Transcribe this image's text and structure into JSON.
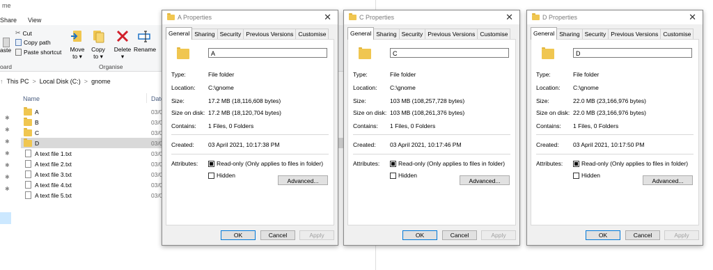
{
  "explorer": {
    "title_fragment": "me",
    "menu_tabs": [
      "Share",
      "View"
    ],
    "ribbon": {
      "cut": "Cut",
      "copy_path": "Copy path",
      "paste_shortcut": "Paste shortcut",
      "paste_fragment": "aste",
      "move_to_line1": "Move",
      "move_to_line2": "to ▾",
      "copy_to_line1": "Copy",
      "copy_to_line2": "to ▾",
      "delete_line1": "Delete",
      "delete_line2": "▾",
      "rename": "Rename",
      "clipboard_fragment": "oard",
      "organise": "Organise"
    },
    "address": {
      "nav_arrow": "↑",
      "crumbs": [
        "This PC",
        "Local Disk (C:)",
        "gnome"
      ],
      "separator": ">"
    },
    "columns": {
      "name": "Name",
      "date": "Date"
    },
    "files": [
      {
        "name": "A",
        "date": "03/0",
        "type": "folder"
      },
      {
        "name": "B",
        "date": "03/0",
        "type": "folder"
      },
      {
        "name": "C",
        "date": "03/0",
        "type": "folder"
      },
      {
        "name": "D",
        "date": "03/0",
        "type": "folder"
      },
      {
        "name": "A text file 1.txt",
        "date": "03/0",
        "type": "text"
      },
      {
        "name": "A text file 2.txt",
        "date": "03/0",
        "type": "text"
      },
      {
        "name": "A text file 3.txt",
        "date": "03/0",
        "type": "text"
      },
      {
        "name": "A text file 4.txt",
        "date": "03/0",
        "type": "text"
      },
      {
        "name": "A text file 5.txt",
        "date": "03/0",
        "type": "text"
      }
    ]
  },
  "labels": {
    "tabs": [
      "General",
      "Sharing",
      "Security",
      "Previous Versions",
      "Customise"
    ],
    "type": "Type:",
    "location": "Location:",
    "size": "Size:",
    "size_on_disk": "Size on disk:",
    "contains": "Contains:",
    "created": "Created:",
    "attributes": "Attributes:",
    "readonly": "Read-only (Only applies to files in folder)",
    "hidden": "Hidden",
    "advanced": "Advanced...",
    "ok": "OK",
    "cancel": "Cancel",
    "apply": "Apply",
    "close_glyph": "✕"
  },
  "dialogs": [
    {
      "title": "A Properties",
      "name": "A",
      "type": "File folder",
      "location": "C:\\gnome",
      "size": "17.2 MB (18,116,608 bytes)",
      "size_on_disk": "17.2 MB (18,120,704 bytes)",
      "contains": "1 Files, 0 Folders",
      "created": "03 April 2021, 10:17:38 PM"
    },
    {
      "title": "C Properties",
      "name": "C",
      "type": "File folder",
      "location": "C:\\gnome",
      "size": "103 MB (108,257,728 bytes)",
      "size_on_disk": "103 MB (108,261,376 bytes)",
      "contains": "1 Files, 0 Folders",
      "created": "03 April 2021, 10:17:46 PM"
    },
    {
      "title": "D Properties",
      "name": "D",
      "type": "File folder",
      "location": "C:\\gnome",
      "size": "22.0 MB (23,166,976 bytes)",
      "size_on_disk": "22.0 MB (23,166,976 bytes)",
      "contains": "1 Files, 0 Folders",
      "created": "03 April 2021, 10:17:50 PM"
    }
  ],
  "colors": {
    "folder": "#f0c650",
    "selection": "#d9d9d9",
    "nav_selection": "#cce8ff",
    "delete_red": "#d1202b",
    "arrow_blue": "#1e72c6"
  },
  "icons": {
    "cut": "scissors-icon",
    "copy_path": "copy-path-icon",
    "paste_shortcut": "paste-shortcut-icon",
    "move_to": "move-to-icon",
    "copy_to": "copy-to-icon",
    "delete": "delete-x-icon",
    "rename": "rename-icon",
    "pin": "pin-icon",
    "folder": "folder-icon",
    "text_file": "text-file-icon"
  }
}
